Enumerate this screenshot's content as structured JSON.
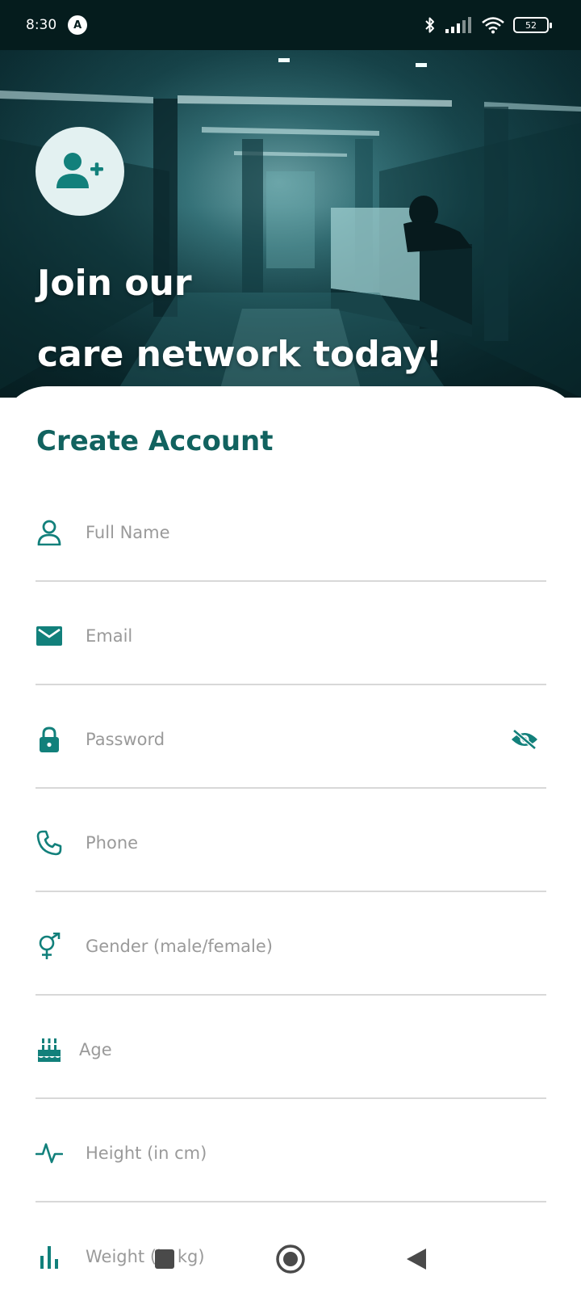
{
  "status_bar": {
    "time": "8:30",
    "app_badge": "A",
    "battery": "52",
    "icons": [
      "bluetooth-icon",
      "signal-icon",
      "wifi-icon",
      "battery-icon"
    ]
  },
  "hero": {
    "title_line1": "Join our",
    "title_line2": "care network today!",
    "avatar_icon": "user-plus-icon"
  },
  "form": {
    "title": "Create Account",
    "fields": [
      {
        "placeholder": "Full Name",
        "value": "",
        "icon": "person-icon"
      },
      {
        "placeholder": "Email",
        "value": "",
        "icon": "mail-icon"
      },
      {
        "placeholder": "Password",
        "value": "",
        "icon": "lock-icon",
        "trailing_icon": "eye-off-icon"
      },
      {
        "placeholder": "Phone",
        "value": "",
        "icon": "phone-icon"
      },
      {
        "placeholder": "Gender (male/female)",
        "value": "",
        "icon": "gender-icon"
      },
      {
        "placeholder": "Age",
        "value": "",
        "icon": "cake-icon"
      },
      {
        "placeholder": "Height (in cm)",
        "value": "",
        "icon": "pulse-icon"
      },
      {
        "placeholder": "Weight (in kg)",
        "value": "",
        "icon": "bar-chart-icon"
      }
    ]
  },
  "colors": {
    "accent": "#11625f",
    "icon_teal": "#12807b",
    "status_bar_bg": "#051c1d"
  },
  "nav_bar": {
    "buttons": [
      "recents-button",
      "home-button",
      "back-button"
    ]
  }
}
